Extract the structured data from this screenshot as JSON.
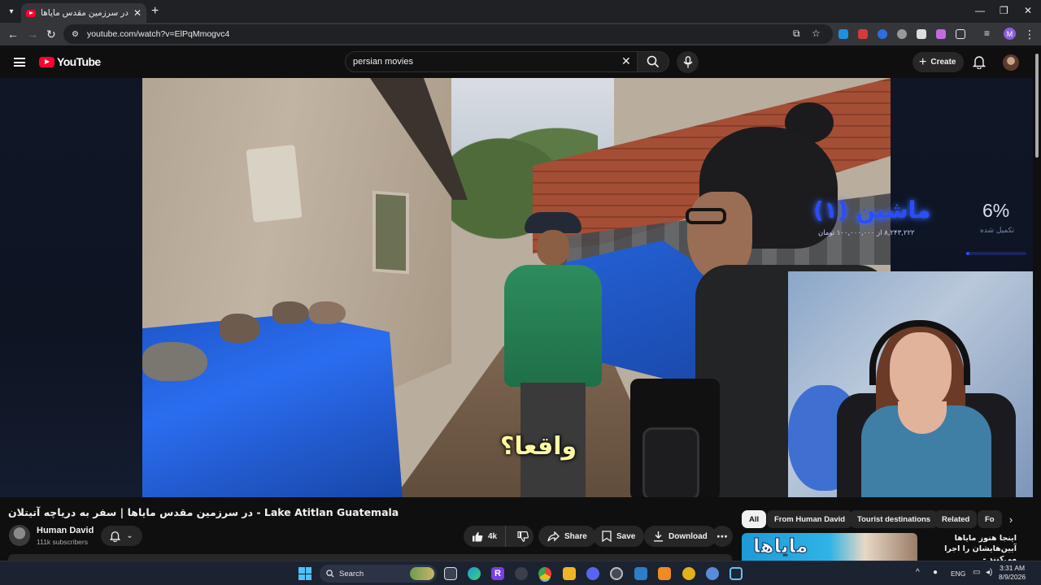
{
  "browser": {
    "tab_title": "در سرزمین مقدس مایاها | سفر به",
    "url": "youtube.com/watch?v=ElPqMmogvc4",
    "profile_initial": "M"
  },
  "header": {
    "logo_text": "YouTube",
    "search_value": "persian movies",
    "create_label": "Create"
  },
  "video": {
    "subtitle": "واقعا؟"
  },
  "overlay": {
    "title": "ماشین (۱)",
    "detail": "۸,۲۴۳,۲۲۲ از ۱۰۰,۰۰۰,۰۰۰ تومان",
    "percent_text": "6%",
    "percent_value": 0.06,
    "percent_label": "تکمیل شده"
  },
  "below": {
    "title": "در سرزمین مقدس مایاها | سفر به دریاچه آتیتلان - Lake Atitlan Guatemala",
    "channel_name": "Human David",
    "subscribers": "111k subscribers",
    "likes": "4k",
    "share_label": "Share",
    "save_label": "Save",
    "download_label": "Download"
  },
  "chips": [
    "All",
    "From Human David",
    "Tourist destinations",
    "Related",
    "Fo"
  ],
  "related": {
    "thumb_text": "مایاها",
    "title": "اینجا هنوز مایاها آیین‌هایشان را اجرا می‌کنند -"
  },
  "taskbar": {
    "search_label": "Search",
    "lang": "ENG",
    "time": "3:31 AM",
    "date": "8/9/2026"
  },
  "colors": {
    "yt_red": "#ff0033",
    "background": "#0f0f0f",
    "overlay_blue": "#2b4dff",
    "start_blue": "#4cc2ff"
  }
}
